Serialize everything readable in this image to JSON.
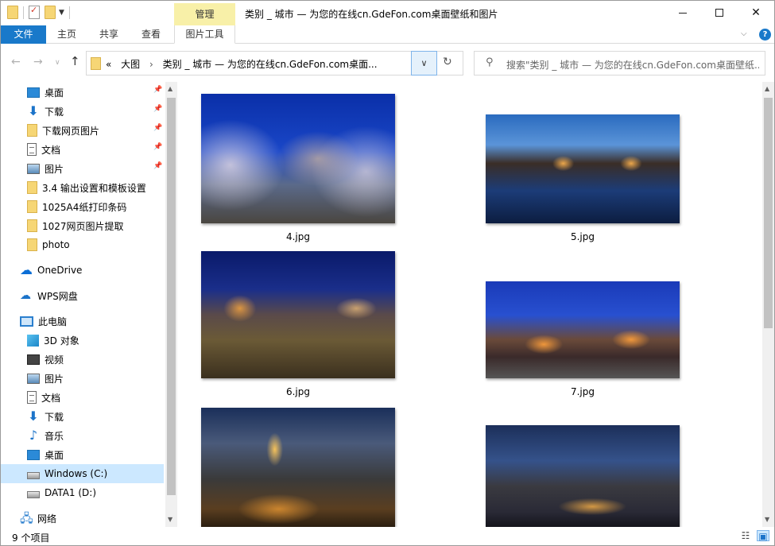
{
  "window": {
    "title": "类别 _ 城市 — 为您的在线cn.GdeFon.com桌面壁纸和图片",
    "tool_tab_header": "管理"
  },
  "ribbon": {
    "tabs": [
      "文件",
      "主页",
      "共享",
      "查看",
      "图片工具"
    ]
  },
  "address": {
    "overflow": "«",
    "crumbs": [
      "大图",
      "类别 _ 城市 — 为您的在线cn.GdeFon.com桌面..."
    ]
  },
  "search": {
    "placeholder": "搜索\"类别 _ 城市 — 为您的在线cn.GdeFon.com桌面壁纸..."
  },
  "nav_pane": {
    "quick_access": [
      {
        "label": "桌面",
        "icon": "desktop-icon",
        "pinned": true
      },
      {
        "label": "下载",
        "icon": "download-icon",
        "pinned": true
      },
      {
        "label": "下载网页图片",
        "icon": "folder-icon",
        "pinned": true
      },
      {
        "label": "文档",
        "icon": "documents-icon",
        "pinned": true
      },
      {
        "label": "图片",
        "icon": "pictures-icon",
        "pinned": true
      },
      {
        "label": "3.4 输出设置和模板设置",
        "icon": "folder-icon",
        "pinned": false
      },
      {
        "label": "1025A4纸打印条码",
        "icon": "folder-icon",
        "pinned": false
      },
      {
        "label": "1027网页图片提取",
        "icon": "folder-icon",
        "pinned": false
      },
      {
        "label": "photo",
        "icon": "folder-icon",
        "pinned": false
      }
    ],
    "onedrive": "OneDrive",
    "wps": "WPS网盘",
    "this_pc": "此电脑",
    "pc_items": [
      {
        "label": "3D 对象",
        "icon": "3d-objects-icon"
      },
      {
        "label": "视频",
        "icon": "videos-icon"
      },
      {
        "label": "图片",
        "icon": "pictures-icon"
      },
      {
        "label": "文档",
        "icon": "documents-icon"
      },
      {
        "label": "下载",
        "icon": "download-icon"
      },
      {
        "label": "音乐",
        "icon": "music-icon"
      },
      {
        "label": "桌面",
        "icon": "desktop-icon"
      },
      {
        "label": "Windows (C:)",
        "icon": "drive-icon",
        "selected": true
      },
      {
        "label": "DATA1 (D:)",
        "icon": "drive-icon"
      }
    ],
    "network": "网络"
  },
  "files": [
    {
      "name": "4.jpg"
    },
    {
      "name": "5.jpg"
    },
    {
      "name": "6.jpg"
    },
    {
      "name": "7.jpg"
    },
    {
      "name": "",
      "partial": true
    },
    {
      "name": "",
      "partial": true
    }
  ],
  "status": {
    "item_count": "9 个项目"
  }
}
